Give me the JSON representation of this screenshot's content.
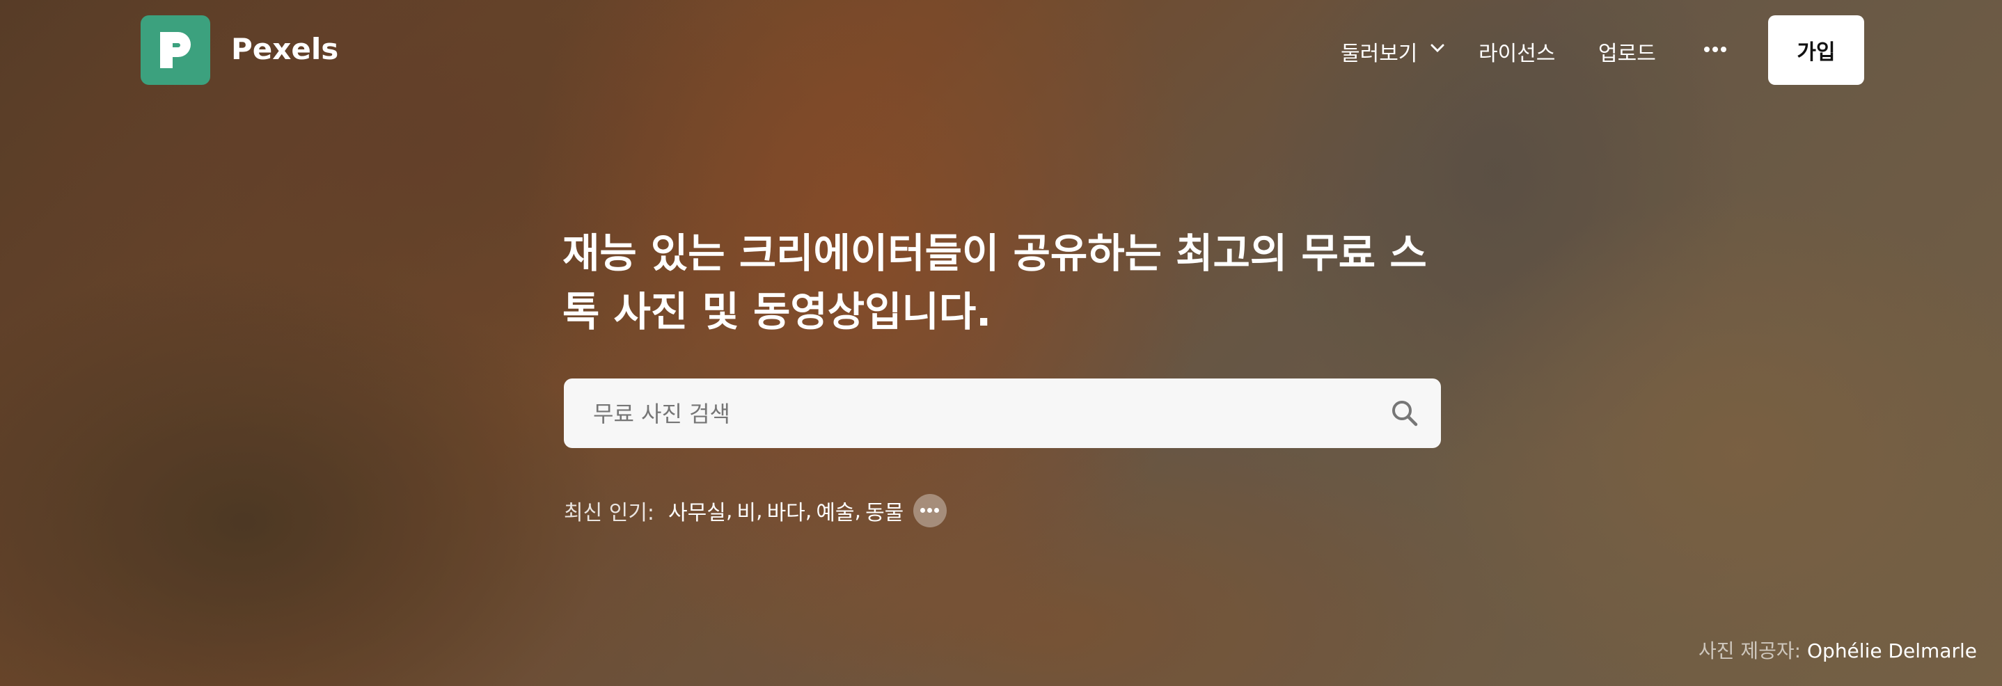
{
  "header": {
    "brand": "Pexels",
    "nav": {
      "explore": "둘러보기",
      "license": "라이선스",
      "upload": "업로드"
    },
    "signup": "가입"
  },
  "hero": {
    "headline": "재능 있는 크리에이터들이 공유하는 최고의 무료 스톡 사진 및 동영상입니다.",
    "search_placeholder": "무료 사진 검색",
    "trending_label": "최신 인기:",
    "trending": [
      "사무실",
      "비",
      "바다",
      "예술",
      "동물"
    ],
    "credit_label": "사진 제공자:",
    "credit_name": "Ophélie Delmarle"
  },
  "icons": {
    "logo": "pexels-logo-icon",
    "chevron": "chevron-down-icon",
    "more": "more-horizontal-icon",
    "search": "search-icon"
  },
  "colors": {
    "brand": "#3ca17e",
    "search_bg": "#f7f7f7"
  }
}
